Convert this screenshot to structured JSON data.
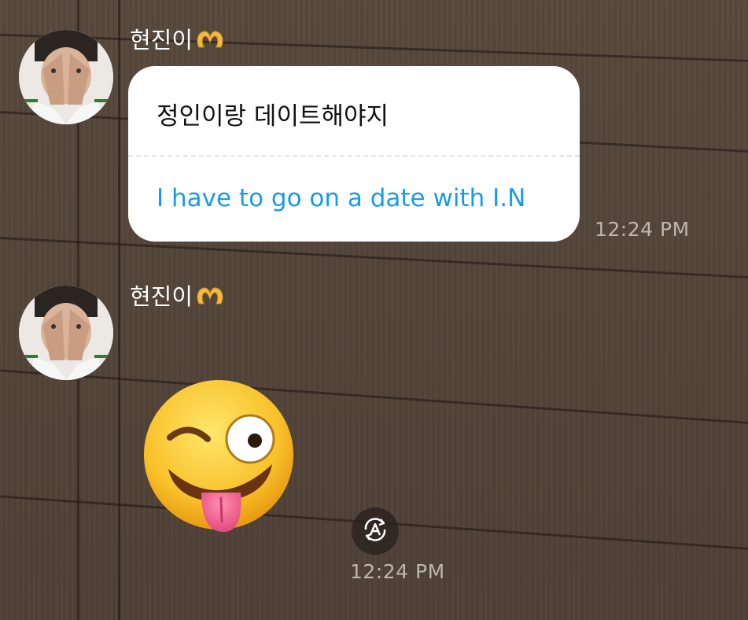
{
  "messages": [
    {
      "sender": "현진이",
      "original_text": "정인이랑 데이트해야지",
      "translated_text": "I have to go on a date with I.N",
      "time": "12:24 PM"
    },
    {
      "sender": "현진이",
      "sticker": "winking-face-with-tongue",
      "time": "12:24 PM"
    }
  ],
  "icons": {
    "sender_badge": "heart-hands-icon",
    "translate": "auto-translate-icon"
  },
  "colors": {
    "translation_text": "#1a9be6",
    "bubble_bg": "#ffffff",
    "timestamp": "#bdb6b0"
  }
}
